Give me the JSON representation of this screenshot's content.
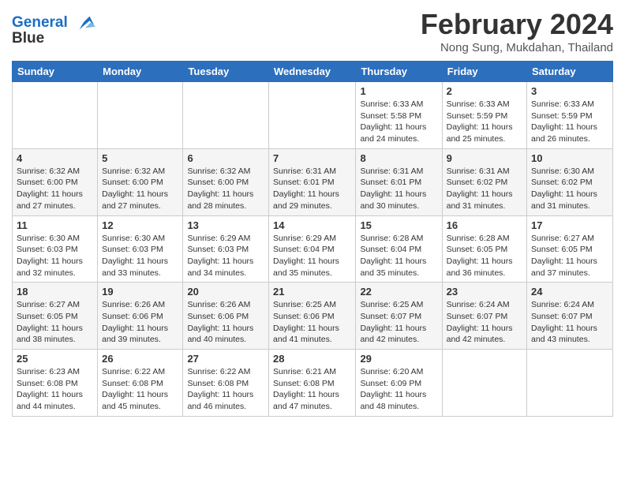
{
  "logo": {
    "line1": "General",
    "line2": "Blue"
  },
  "title": "February 2024",
  "location": "Nong Sung, Mukdahan, Thailand",
  "days_of_week": [
    "Sunday",
    "Monday",
    "Tuesday",
    "Wednesday",
    "Thursday",
    "Friday",
    "Saturday"
  ],
  "weeks": [
    [
      {
        "day": "",
        "info": ""
      },
      {
        "day": "",
        "info": ""
      },
      {
        "day": "",
        "info": ""
      },
      {
        "day": "",
        "info": ""
      },
      {
        "day": "1",
        "info": "Sunrise: 6:33 AM\nSunset: 5:58 PM\nDaylight: 11 hours\nand 24 minutes."
      },
      {
        "day": "2",
        "info": "Sunrise: 6:33 AM\nSunset: 5:59 PM\nDaylight: 11 hours\nand 25 minutes."
      },
      {
        "day": "3",
        "info": "Sunrise: 6:33 AM\nSunset: 5:59 PM\nDaylight: 11 hours\nand 26 minutes."
      }
    ],
    [
      {
        "day": "4",
        "info": "Sunrise: 6:32 AM\nSunset: 6:00 PM\nDaylight: 11 hours\nand 27 minutes."
      },
      {
        "day": "5",
        "info": "Sunrise: 6:32 AM\nSunset: 6:00 PM\nDaylight: 11 hours\nand 27 minutes."
      },
      {
        "day": "6",
        "info": "Sunrise: 6:32 AM\nSunset: 6:00 PM\nDaylight: 11 hours\nand 28 minutes."
      },
      {
        "day": "7",
        "info": "Sunrise: 6:31 AM\nSunset: 6:01 PM\nDaylight: 11 hours\nand 29 minutes."
      },
      {
        "day": "8",
        "info": "Sunrise: 6:31 AM\nSunset: 6:01 PM\nDaylight: 11 hours\nand 30 minutes."
      },
      {
        "day": "9",
        "info": "Sunrise: 6:31 AM\nSunset: 6:02 PM\nDaylight: 11 hours\nand 31 minutes."
      },
      {
        "day": "10",
        "info": "Sunrise: 6:30 AM\nSunset: 6:02 PM\nDaylight: 11 hours\nand 31 minutes."
      }
    ],
    [
      {
        "day": "11",
        "info": "Sunrise: 6:30 AM\nSunset: 6:03 PM\nDaylight: 11 hours\nand 32 minutes."
      },
      {
        "day": "12",
        "info": "Sunrise: 6:30 AM\nSunset: 6:03 PM\nDaylight: 11 hours\nand 33 minutes."
      },
      {
        "day": "13",
        "info": "Sunrise: 6:29 AM\nSunset: 6:03 PM\nDaylight: 11 hours\nand 34 minutes."
      },
      {
        "day": "14",
        "info": "Sunrise: 6:29 AM\nSunset: 6:04 PM\nDaylight: 11 hours\nand 35 minutes."
      },
      {
        "day": "15",
        "info": "Sunrise: 6:28 AM\nSunset: 6:04 PM\nDaylight: 11 hours\nand 35 minutes."
      },
      {
        "day": "16",
        "info": "Sunrise: 6:28 AM\nSunset: 6:05 PM\nDaylight: 11 hours\nand 36 minutes."
      },
      {
        "day": "17",
        "info": "Sunrise: 6:27 AM\nSunset: 6:05 PM\nDaylight: 11 hours\nand 37 minutes."
      }
    ],
    [
      {
        "day": "18",
        "info": "Sunrise: 6:27 AM\nSunset: 6:05 PM\nDaylight: 11 hours\nand 38 minutes."
      },
      {
        "day": "19",
        "info": "Sunrise: 6:26 AM\nSunset: 6:06 PM\nDaylight: 11 hours\nand 39 minutes."
      },
      {
        "day": "20",
        "info": "Sunrise: 6:26 AM\nSunset: 6:06 PM\nDaylight: 11 hours\nand 40 minutes."
      },
      {
        "day": "21",
        "info": "Sunrise: 6:25 AM\nSunset: 6:06 PM\nDaylight: 11 hours\nand 41 minutes."
      },
      {
        "day": "22",
        "info": "Sunrise: 6:25 AM\nSunset: 6:07 PM\nDaylight: 11 hours\nand 42 minutes."
      },
      {
        "day": "23",
        "info": "Sunrise: 6:24 AM\nSunset: 6:07 PM\nDaylight: 11 hours\nand 42 minutes."
      },
      {
        "day": "24",
        "info": "Sunrise: 6:24 AM\nSunset: 6:07 PM\nDaylight: 11 hours\nand 43 minutes."
      }
    ],
    [
      {
        "day": "25",
        "info": "Sunrise: 6:23 AM\nSunset: 6:08 PM\nDaylight: 11 hours\nand 44 minutes."
      },
      {
        "day": "26",
        "info": "Sunrise: 6:22 AM\nSunset: 6:08 PM\nDaylight: 11 hours\nand 45 minutes."
      },
      {
        "day": "27",
        "info": "Sunrise: 6:22 AM\nSunset: 6:08 PM\nDaylight: 11 hours\nand 46 minutes."
      },
      {
        "day": "28",
        "info": "Sunrise: 6:21 AM\nSunset: 6:08 PM\nDaylight: 11 hours\nand 47 minutes."
      },
      {
        "day": "29",
        "info": "Sunrise: 6:20 AM\nSunset: 6:09 PM\nDaylight: 11 hours\nand 48 minutes."
      },
      {
        "day": "",
        "info": ""
      },
      {
        "day": "",
        "info": ""
      }
    ]
  ]
}
